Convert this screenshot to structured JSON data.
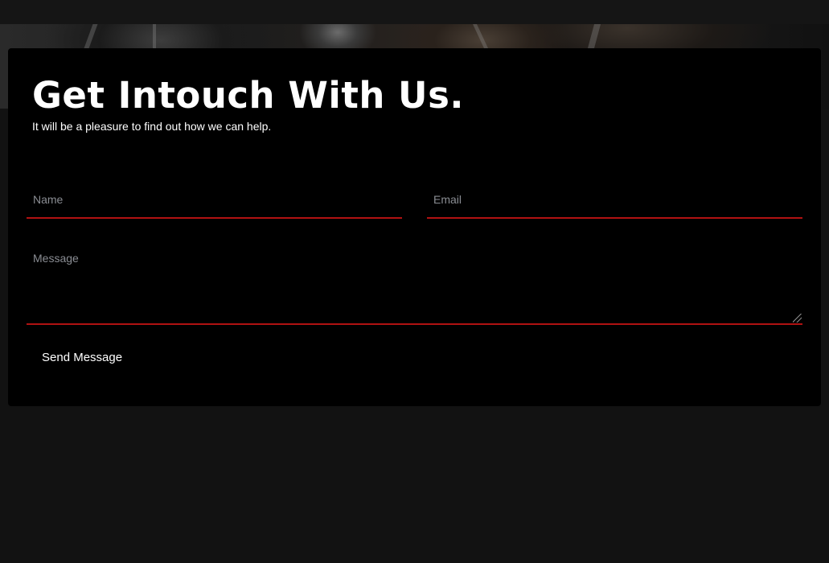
{
  "contact": {
    "title": "Get Intouch With Us.",
    "subtitle": "It will be a pleasure to find out how we can help.",
    "name_placeholder": "Name",
    "name_value": "",
    "email_placeholder": "Email",
    "email_value": "",
    "message_placeholder": "Message",
    "message_value": "",
    "send_label": "Send Message"
  },
  "colors": {
    "page_background": "#121212",
    "card_background": "#000000",
    "field_underline": "#b01212",
    "text": "#ffffff",
    "placeholder": "#8a8d93"
  },
  "icons": {
    "textarea_resize": "resize-grip-icon"
  }
}
